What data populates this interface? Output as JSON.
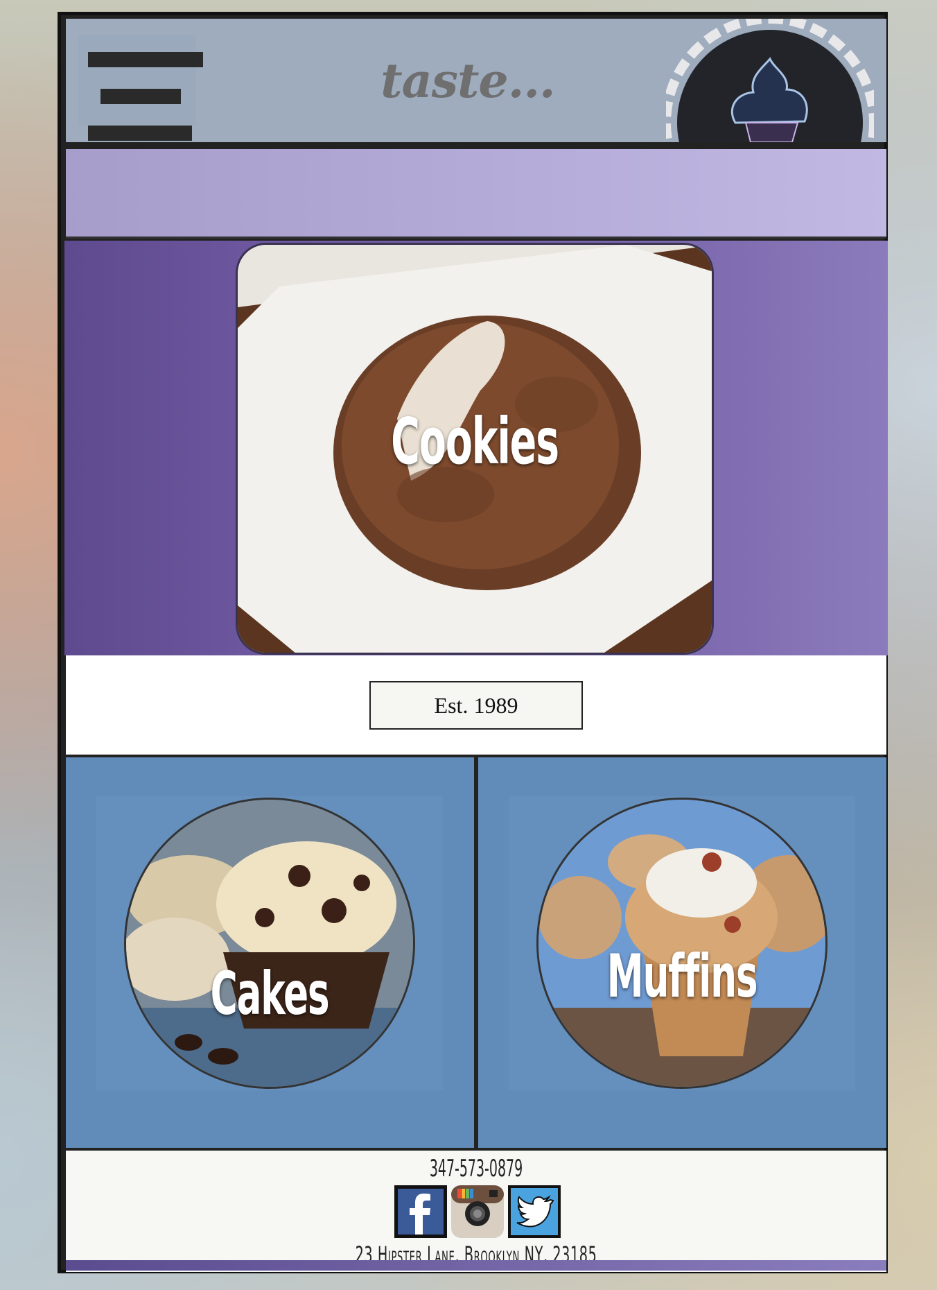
{
  "header": {
    "logo_text": "taste...",
    "menu_icon": "hamburger-menu-icon",
    "brand_icon": "cupcake-icon"
  },
  "hero": {
    "label": "Cookies"
  },
  "est": {
    "text": "Est. 1989"
  },
  "tiles": [
    {
      "label": "Cakes"
    },
    {
      "label": "Muffins"
    }
  ],
  "footer": {
    "phone": "347-573-0879",
    "social_icons": [
      "facebook-icon",
      "instagram-icon",
      "twitter-icon"
    ],
    "address": "23 Hipster Lane, Brooklyn NY, 23185"
  },
  "colors": {
    "header_bg": "#9eacbe",
    "banner": "#b3aad8",
    "hero_bg": "#6e58a0",
    "tile_bg": "#618bb8",
    "frame": "#111111"
  }
}
